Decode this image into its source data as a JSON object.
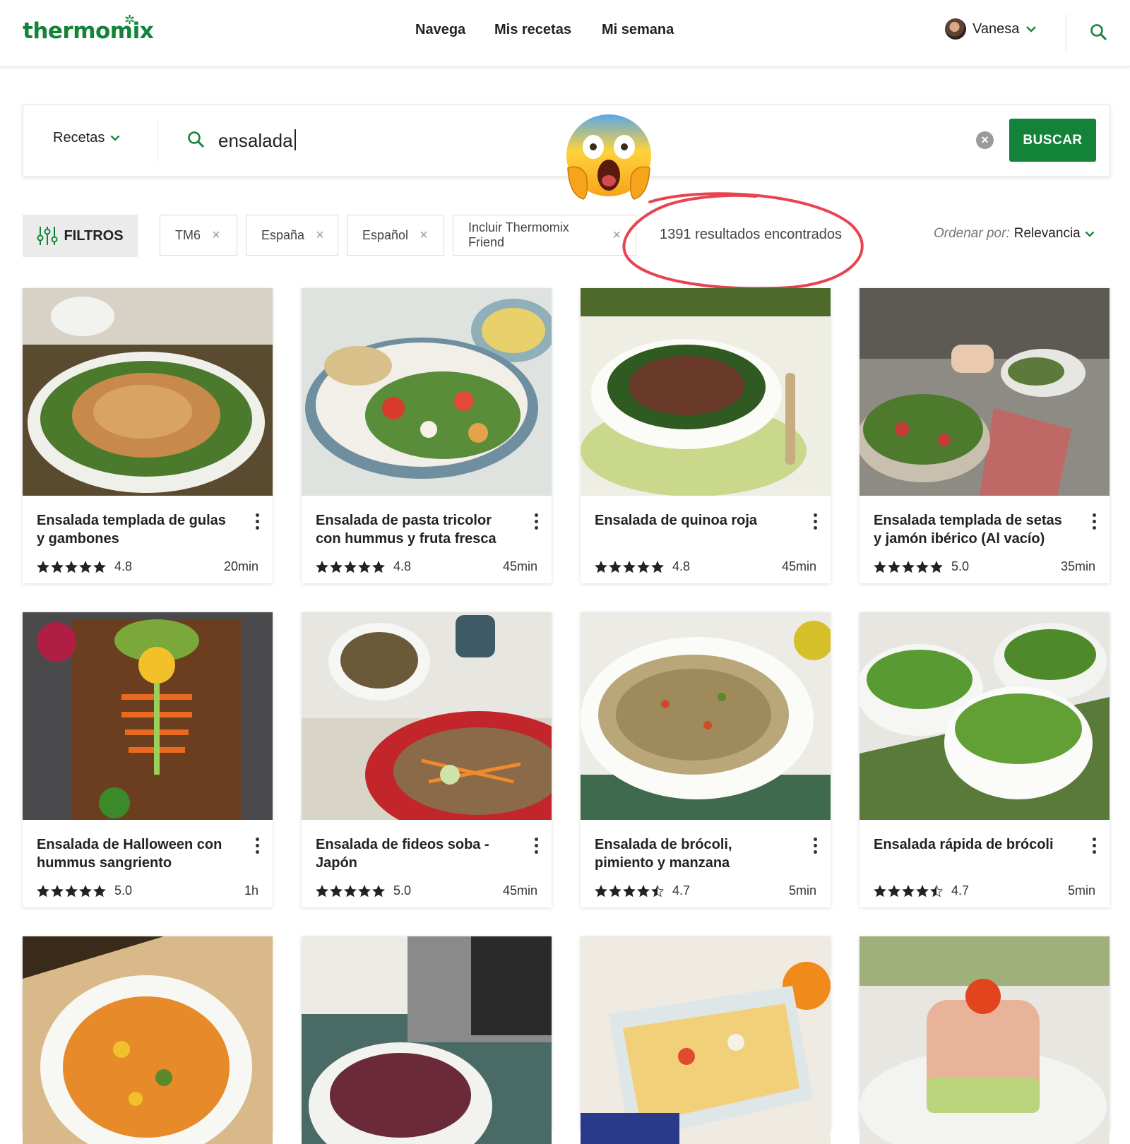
{
  "header": {
    "logo": "thermomix",
    "nav": [
      "Navega",
      "Mis recetas",
      "Mi semana"
    ],
    "user": "Vanesa"
  },
  "search": {
    "category": "Recetas",
    "value": "ensalada",
    "button": "BUSCAR"
  },
  "filters": {
    "button": "FILTROS",
    "chips": [
      "TM6",
      "España",
      "Español",
      "Incluir Thermomix Friend"
    ],
    "results": "1391 resultados encontrados",
    "order_label": "Ordenar por:",
    "order_value": "Relevancia"
  },
  "recipes": [
    {
      "title": "Ensalada templada de gulas y gambones",
      "rating": "4.8",
      "stars": 5,
      "time": "20min"
    },
    {
      "title": "Ensalada de pasta tricolor con hummus y fruta fresca",
      "rating": "4.8",
      "stars": 5,
      "time": "45min"
    },
    {
      "title": "Ensalada de quinoa roja",
      "rating": "4.8",
      "stars": 5,
      "time": "45min"
    },
    {
      "title": "Ensalada templada de setas y jamón ibérico (Al vacío)",
      "rating": "5.0",
      "stars": 5,
      "time": "35min"
    },
    {
      "title": "Ensalada de Halloween con hummus sangriento",
      "rating": "5.0",
      "stars": 5,
      "time": "1h"
    },
    {
      "title": "Ensalada de fideos soba - Japón",
      "rating": "5.0",
      "stars": 5,
      "time": "45min"
    },
    {
      "title": "Ensalada de brócoli, pimiento y manzana",
      "rating": "4.7",
      "stars": 4.5,
      "time": "5min"
    },
    {
      "title": "Ensalada rápida de brócoli",
      "rating": "4.7",
      "stars": 4.5,
      "time": "5min"
    }
  ],
  "colors": {
    "brand_green": "#14833a",
    "annotation_red": "#e8434f"
  }
}
